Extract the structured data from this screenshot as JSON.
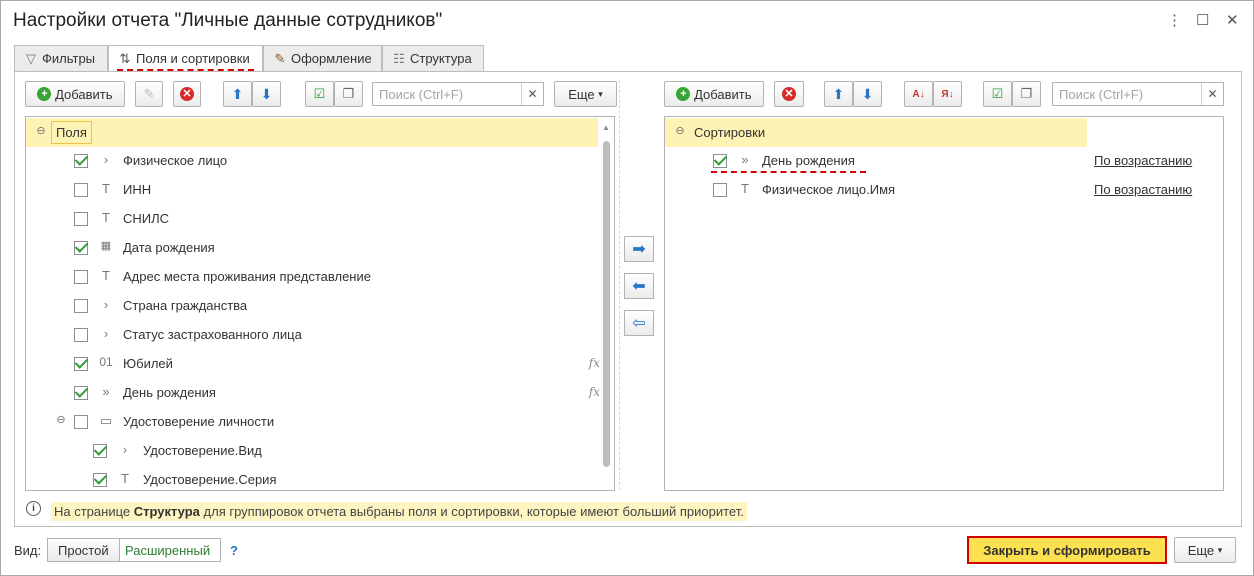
{
  "window": {
    "title": "Настройки отчета \"Личные данные сотрудников\"",
    "controls": [
      "⋮",
      "☐",
      "✕"
    ]
  },
  "tabs": [
    {
      "label": "Фильтры",
      "icon": "filter-icon",
      "active": false
    },
    {
      "label": "Поля и сортировки",
      "icon": "fields-sort-icon",
      "active": true
    },
    {
      "label": "Оформление",
      "icon": "brush-icon",
      "active": false
    },
    {
      "label": "Структура",
      "icon": "structure-icon",
      "active": false
    }
  ],
  "left_toolbar": {
    "add_label": "Добавить",
    "search_placeholder": "Поиск (Ctrl+F)",
    "more_label": "Еще"
  },
  "right_toolbar": {
    "add_label": "Добавить",
    "search_placeholder": "Поиск (Ctrl+F)"
  },
  "fields_tree": {
    "root_label": "Поля",
    "items": [
      {
        "label": "Физическое лицо",
        "checked": true,
        "icon": "chevron-right-icon"
      },
      {
        "label": "ИНН",
        "checked": false,
        "icon": "text-type-icon"
      },
      {
        "label": "СНИЛС",
        "checked": false,
        "icon": "text-type-icon"
      },
      {
        "label": "Дата рождения",
        "checked": true,
        "icon": "calendar-icon"
      },
      {
        "label": "Адрес места проживания представление",
        "checked": false,
        "icon": "text-type-icon"
      },
      {
        "label": "Страна гражданства",
        "checked": false,
        "icon": "chevron-right-icon"
      },
      {
        "label": "Статус застрахованного лица",
        "checked": false,
        "icon": "chevron-right-icon"
      },
      {
        "label": "Юбилей",
        "checked": true,
        "icon": "number-type-icon",
        "fx": "fx"
      },
      {
        "label": "День рождения",
        "checked": true,
        "icon": "double-chevron-icon",
        "fx": "fx"
      },
      {
        "label": "Удостоверение личности",
        "checked": false,
        "icon": "folder-icon"
      },
      {
        "label": "Удостоверение.Вид",
        "checked": true,
        "icon": "chevron-right-icon"
      },
      {
        "label": "Удостоверение.Серия",
        "checked": true,
        "icon": "text-type-icon"
      }
    ]
  },
  "sort_tree": {
    "root_label": "Сортировки",
    "items": [
      {
        "label": "День рождения",
        "checked": true,
        "direction": "По возрастанию",
        "icon": "double-chevron-icon"
      },
      {
        "label": "Физическое лицо.Имя",
        "checked": false,
        "direction": "По возрастанию",
        "icon": "text-type-icon"
      }
    ]
  },
  "info": {
    "prefix": "На странице ",
    "bold": "Структура",
    "suffix": " для группировок отчета выбраны поля и сортировки, которые имеют больший приоритет."
  },
  "bottom": {
    "view_label": "Вид:",
    "simple_label": "Простой",
    "extended_label": "Расширенный",
    "help": "?",
    "close_generate_label": "Закрыть и сформировать",
    "more_label": "Еще"
  }
}
